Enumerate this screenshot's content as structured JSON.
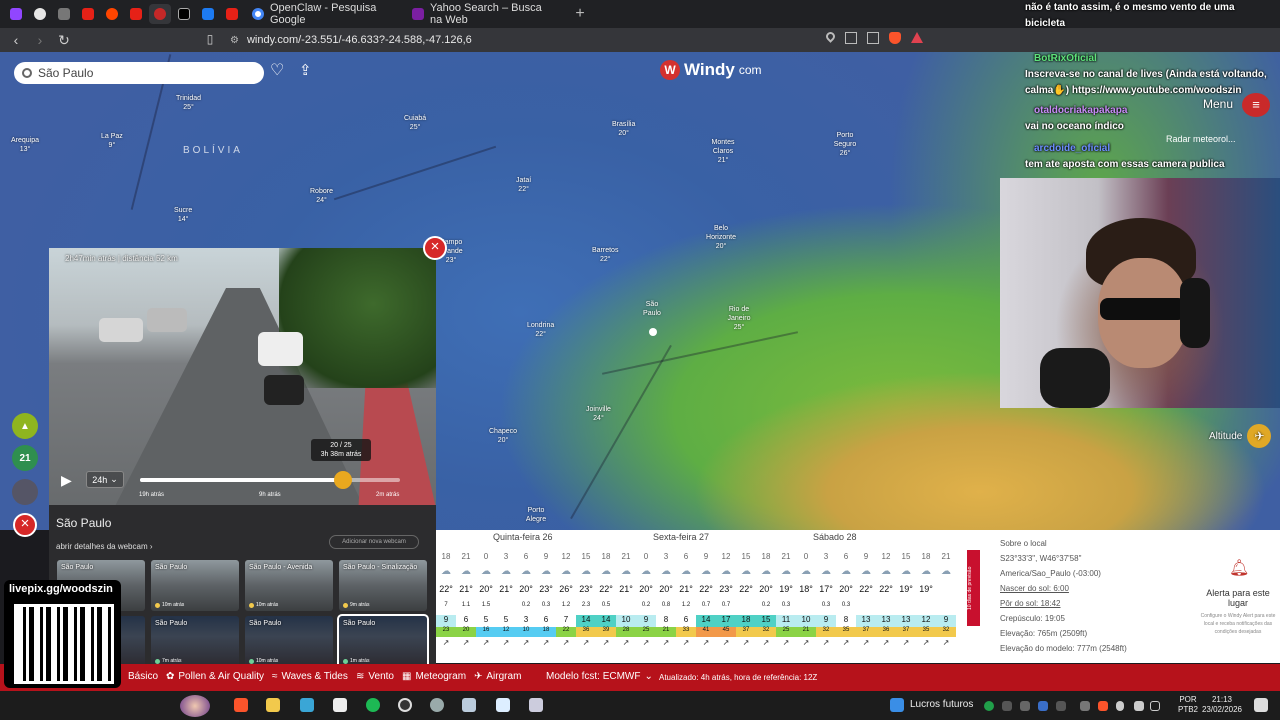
{
  "browser": {
    "tabs": [
      {
        "title": "OpenClaw - Pesquisa Google",
        "color": "#4285f4"
      },
      {
        "title": "Yahoo Search – Busca na Web",
        "color": "#7b1fa2"
      }
    ],
    "url": "windy.com/-23.551/-46.633?-24.588,-47.126,6"
  },
  "windy": {
    "search_value": "São Paulo",
    "logo": "Windy",
    "logo_suffix": "com",
    "countries": [
      {
        "label": "BOLÍVIA"
      }
    ],
    "cities": [
      {
        "name": "Trinidad",
        "temp": "25°"
      },
      {
        "name": "La Paz",
        "temp": "9°"
      },
      {
        "name": "Arequipa",
        "temp": "13°"
      },
      {
        "name": "Cuiabá",
        "temp": "25°"
      },
      {
        "name": "Robore",
        "temp": "24°"
      },
      {
        "name": "Sucre",
        "temp": "14°"
      },
      {
        "name": "Brasília",
        "temp": "20°"
      },
      {
        "name": "Montes Claros",
        "temp": "21°"
      },
      {
        "name": "Porto Seguro",
        "temp": "26°"
      },
      {
        "name": "Jataí",
        "temp": "22°"
      },
      {
        "name": "Belo Horizonte",
        "temp": "20°"
      },
      {
        "name": "Barretos",
        "temp": "22°"
      },
      {
        "name": "São Paulo",
        "temp": ""
      },
      {
        "name": "Rio de Janeiro",
        "temp": "25°"
      },
      {
        "name": "Londrina",
        "temp": "22°"
      },
      {
        "name": "Joinville",
        "temp": "24°"
      },
      {
        "name": "Chapeco",
        "temp": "20°"
      },
      {
        "name": "Porto Alegre",
        "temp": ""
      },
      {
        "name": "Campo Grande",
        "temp": "23°"
      }
    ],
    "side_buttons": [
      "21"
    ],
    "altitude_label": "Altitude",
    "radar_label": "Radar meteorol...",
    "menu_label": "Menu"
  },
  "webcam": {
    "caption": "2h47min atrás | distância 52 km",
    "range_value": "24h",
    "tooltip_line1": "20 / 25",
    "tooltip_line2": "3h 38m atrás",
    "progress": 0.78,
    "ticks": [
      "19h atrás",
      "9h atrás",
      "2m atrás"
    ],
    "title": "São Paulo",
    "details_link": "abrir detalhes da webcam",
    "add_button": "Adicionar nova webcam",
    "thumbnails": [
      {
        "name": "São Paulo",
        "age": "",
        "dot": "#f2c94c",
        "night": false
      },
      {
        "name": "São Paulo",
        "age": "10m atrás",
        "dot": "#f2c94c",
        "night": false
      },
      {
        "name": "São Paulo - Avenida",
        "age": "10m atrás",
        "dot": "#f2c94c",
        "night": false
      },
      {
        "name": "São Paulo - Sinalização",
        "age": "9m atrás",
        "dot": "#f2c94c",
        "night": false
      },
      {
        "name": "",
        "age": "",
        "dot": "#6fcf97",
        "night": true
      },
      {
        "name": "São Paulo",
        "age": "7m atrás",
        "dot": "#6fcf97",
        "night": true
      },
      {
        "name": "São Paulo",
        "age": "10m atrás",
        "dot": "#6fcf97",
        "night": true
      },
      {
        "name": "São Paulo",
        "age": "1m atrás",
        "dot": "#6fcf97",
        "night": true
      }
    ]
  },
  "forecast": {
    "days": [
      "Quinta-feira 26",
      "Sexta-feira 27",
      "Sábado 28"
    ],
    "hours": [
      "18",
      "21",
      "0",
      "3",
      "6",
      "9",
      "12",
      "15",
      "18",
      "21",
      "0",
      "3",
      "6",
      "9",
      "12",
      "15",
      "18",
      "21",
      "0",
      "3",
      "6",
      "9",
      "12",
      "15",
      "18",
      "21",
      "0",
      "3",
      "6",
      "9",
      "12",
      "15",
      "18",
      "21",
      "0",
      "3",
      "6",
      "9",
      "12",
      "15",
      "18",
      "21",
      "0",
      "3",
      "6",
      "9",
      "12",
      "15",
      "18"
    ],
    "temps": [
      "22°",
      "21°",
      "20°",
      "21°",
      "20°",
      "23°",
      "26°",
      "23°",
      "22°",
      "21°",
      "20°",
      "20°",
      "21°",
      "22°",
      "23°",
      "22°",
      "20°",
      "19°",
      "18°",
      "17°",
      "20°",
      "22°",
      "22°",
      "19°",
      "19°"
    ],
    "rain": [
      "7",
      "1.1",
      "1.5",
      "",
      "0.2",
      "0.3",
      "1.2",
      "2.3",
      "0.5",
      "",
      "0.2",
      "0.8",
      "1.2",
      "0.7",
      "0.7",
      "",
      "0.2",
      "0.3",
      "",
      "0.3",
      "0.3",
      "",
      "",
      "",
      "",
      ""
    ],
    "wind": [
      "9",
      "6",
      "5",
      "5",
      "3",
      "6",
      "7",
      "14",
      "14",
      "10",
      "9",
      "8",
      "6",
      "14",
      "17",
      "18",
      "15",
      "11",
      "10",
      "9",
      "8",
      "13",
      "13",
      "13",
      "12",
      "9"
    ],
    "gust": [
      "23",
      "20",
      "16",
      "12",
      "10",
      "18",
      "22",
      "36",
      "39",
      "28",
      "25",
      "21",
      "33",
      "41",
      "45",
      "37",
      "32",
      "25",
      "21",
      "32",
      "35",
      "37",
      "36",
      "37",
      "35",
      "32"
    ],
    "tab_label": "10 dias de previsão",
    "info": {
      "title": "Sobre o local",
      "coords": "S23°33'3\", W46°37'58\"",
      "timezone": "America/Sao_Paulo (-03:00)",
      "sunrise": "Nascer do sol: 6:00",
      "sunset": "Pôr do sol: 18:42",
      "twilight": "Crepúsculo: 19:05",
      "elevation": "Elevação: 765m (2509ft)",
      "model_elevation": "Elevação do modelo: 777m (2548ft)"
    },
    "alert_title": "Alerta para este lugar",
    "alert_sub": "Configure o Windy Alert para este local e receba notificações das condições desejadas"
  },
  "bottom_menu": {
    "items": [
      "Básico",
      "Pollen & Air Quality",
      "Waves & Tides",
      "Vento",
      "Meteogram",
      "Airgram"
    ],
    "model": "Modelo fcst: ECMWF",
    "updated": "Atualizado: 4h atrás, hora de referência: 12Z"
  },
  "taskbar": {
    "news": "Lucros futuros",
    "lang": "POR",
    "layout": "PTB2",
    "time": "21:13",
    "date": "23/02/2026"
  },
  "stream": {
    "chat_top": "não é tanto assim, é o mesmo vento de uma bicicleta",
    "messages": [
      {
        "user": "BotRixOficial",
        "color": "#1f8a3b",
        "text": "Inscreva-se no canal de lives (Ainda está voltando, calma✋) https://www.youtube.com/woodszin"
      },
      {
        "user": "otaldocriakapakapa",
        "color": "#7b2fb0",
        "text": "vai no oceano índico"
      },
      {
        "user": "arcdoide_oficial",
        "color": "#3b5bdb",
        "text": "tem ate aposta com essas camera publica"
      }
    ],
    "donation_label": "livepix.gg/woodszin"
  }
}
